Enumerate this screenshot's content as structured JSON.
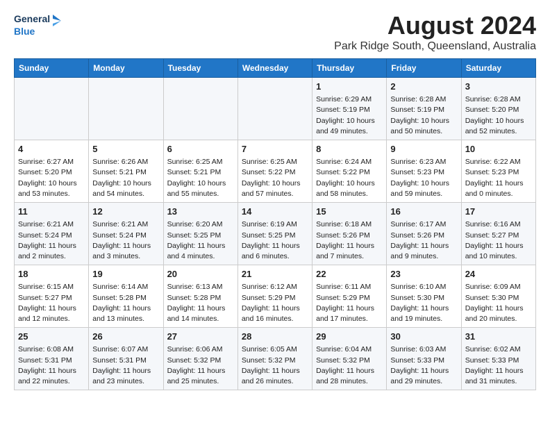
{
  "logo": {
    "line1": "General",
    "line2": "Blue"
  },
  "title": "August 2024",
  "subtitle": "Park Ridge South, Queensland, Australia",
  "days_of_week": [
    "Sunday",
    "Monday",
    "Tuesday",
    "Wednesday",
    "Thursday",
    "Friday",
    "Saturday"
  ],
  "weeks": [
    [
      {
        "day": "",
        "info": ""
      },
      {
        "day": "",
        "info": ""
      },
      {
        "day": "",
        "info": ""
      },
      {
        "day": "",
        "info": ""
      },
      {
        "day": "1",
        "info": "Sunrise: 6:29 AM\nSunset: 5:19 PM\nDaylight: 10 hours\nand 49 minutes."
      },
      {
        "day": "2",
        "info": "Sunrise: 6:28 AM\nSunset: 5:19 PM\nDaylight: 10 hours\nand 50 minutes."
      },
      {
        "day": "3",
        "info": "Sunrise: 6:28 AM\nSunset: 5:20 PM\nDaylight: 10 hours\nand 52 minutes."
      }
    ],
    [
      {
        "day": "4",
        "info": "Sunrise: 6:27 AM\nSunset: 5:20 PM\nDaylight: 10 hours\nand 53 minutes."
      },
      {
        "day": "5",
        "info": "Sunrise: 6:26 AM\nSunset: 5:21 PM\nDaylight: 10 hours\nand 54 minutes."
      },
      {
        "day": "6",
        "info": "Sunrise: 6:25 AM\nSunset: 5:21 PM\nDaylight: 10 hours\nand 55 minutes."
      },
      {
        "day": "7",
        "info": "Sunrise: 6:25 AM\nSunset: 5:22 PM\nDaylight: 10 hours\nand 57 minutes."
      },
      {
        "day": "8",
        "info": "Sunrise: 6:24 AM\nSunset: 5:22 PM\nDaylight: 10 hours\nand 58 minutes."
      },
      {
        "day": "9",
        "info": "Sunrise: 6:23 AM\nSunset: 5:23 PM\nDaylight: 10 hours\nand 59 minutes."
      },
      {
        "day": "10",
        "info": "Sunrise: 6:22 AM\nSunset: 5:23 PM\nDaylight: 11 hours\nand 0 minutes."
      }
    ],
    [
      {
        "day": "11",
        "info": "Sunrise: 6:21 AM\nSunset: 5:24 PM\nDaylight: 11 hours\nand 2 minutes."
      },
      {
        "day": "12",
        "info": "Sunrise: 6:21 AM\nSunset: 5:24 PM\nDaylight: 11 hours\nand 3 minutes."
      },
      {
        "day": "13",
        "info": "Sunrise: 6:20 AM\nSunset: 5:25 PM\nDaylight: 11 hours\nand 4 minutes."
      },
      {
        "day": "14",
        "info": "Sunrise: 6:19 AM\nSunset: 5:25 PM\nDaylight: 11 hours\nand 6 minutes."
      },
      {
        "day": "15",
        "info": "Sunrise: 6:18 AM\nSunset: 5:26 PM\nDaylight: 11 hours\nand 7 minutes."
      },
      {
        "day": "16",
        "info": "Sunrise: 6:17 AM\nSunset: 5:26 PM\nDaylight: 11 hours\nand 9 minutes."
      },
      {
        "day": "17",
        "info": "Sunrise: 6:16 AM\nSunset: 5:27 PM\nDaylight: 11 hours\nand 10 minutes."
      }
    ],
    [
      {
        "day": "18",
        "info": "Sunrise: 6:15 AM\nSunset: 5:27 PM\nDaylight: 11 hours\nand 12 minutes."
      },
      {
        "day": "19",
        "info": "Sunrise: 6:14 AM\nSunset: 5:28 PM\nDaylight: 11 hours\nand 13 minutes."
      },
      {
        "day": "20",
        "info": "Sunrise: 6:13 AM\nSunset: 5:28 PM\nDaylight: 11 hours\nand 14 minutes."
      },
      {
        "day": "21",
        "info": "Sunrise: 6:12 AM\nSunset: 5:29 PM\nDaylight: 11 hours\nand 16 minutes."
      },
      {
        "day": "22",
        "info": "Sunrise: 6:11 AM\nSunset: 5:29 PM\nDaylight: 11 hours\nand 17 minutes."
      },
      {
        "day": "23",
        "info": "Sunrise: 6:10 AM\nSunset: 5:30 PM\nDaylight: 11 hours\nand 19 minutes."
      },
      {
        "day": "24",
        "info": "Sunrise: 6:09 AM\nSunset: 5:30 PM\nDaylight: 11 hours\nand 20 minutes."
      }
    ],
    [
      {
        "day": "25",
        "info": "Sunrise: 6:08 AM\nSunset: 5:31 PM\nDaylight: 11 hours\nand 22 minutes."
      },
      {
        "day": "26",
        "info": "Sunrise: 6:07 AM\nSunset: 5:31 PM\nDaylight: 11 hours\nand 23 minutes."
      },
      {
        "day": "27",
        "info": "Sunrise: 6:06 AM\nSunset: 5:32 PM\nDaylight: 11 hours\nand 25 minutes."
      },
      {
        "day": "28",
        "info": "Sunrise: 6:05 AM\nSunset: 5:32 PM\nDaylight: 11 hours\nand 26 minutes."
      },
      {
        "day": "29",
        "info": "Sunrise: 6:04 AM\nSunset: 5:32 PM\nDaylight: 11 hours\nand 28 minutes."
      },
      {
        "day": "30",
        "info": "Sunrise: 6:03 AM\nSunset: 5:33 PM\nDaylight: 11 hours\nand 29 minutes."
      },
      {
        "day": "31",
        "info": "Sunrise: 6:02 AM\nSunset: 5:33 PM\nDaylight: 11 hours\nand 31 minutes."
      }
    ]
  ]
}
